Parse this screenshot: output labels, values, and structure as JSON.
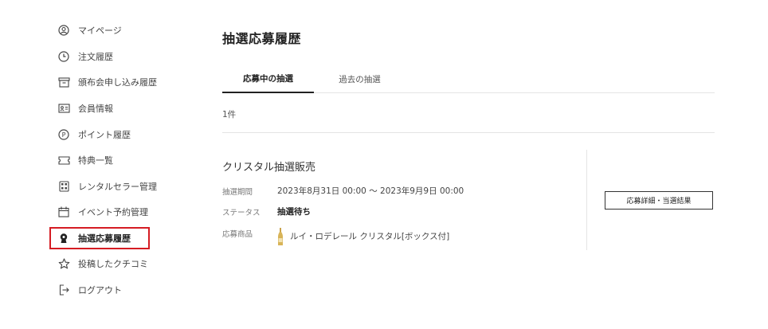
{
  "sidebar": {
    "items": [
      {
        "label": "マイページ",
        "icon": "person-circle-icon"
      },
      {
        "label": "注文履歴",
        "icon": "clock-icon"
      },
      {
        "label": "頒布会申し込み履歴",
        "icon": "box-icon"
      },
      {
        "label": "会員情報",
        "icon": "id-card-icon"
      },
      {
        "label": "ポイント履歴",
        "icon": "point-icon"
      },
      {
        "label": "特典一覧",
        "icon": "ticket-icon"
      },
      {
        "label": "レンタルセラー管理",
        "icon": "cellar-icon"
      },
      {
        "label": "イベント予約管理",
        "icon": "calendar-icon"
      },
      {
        "label": "抽選応募履歴",
        "icon": "lottery-icon",
        "active": true
      },
      {
        "label": "投稿したクチコミ",
        "icon": "star-icon"
      },
      {
        "label": "ログアウト",
        "icon": "logout-icon"
      }
    ],
    "active_border_color": "#d51c23"
  },
  "main": {
    "title": "抽選応募履歴",
    "tabs": [
      {
        "label": "応募中の抽選",
        "active": true
      },
      {
        "label": "過去の抽選",
        "active": false
      }
    ],
    "count": "1件",
    "entry": {
      "title": "クリスタル抽選販売",
      "period_label": "抽選期間",
      "period_value": "2023年8月31日 00:00 〜 2023年9月9日 00:00",
      "status_label": "ステータス",
      "status_value": "抽選待ち",
      "product_label": "応募商品",
      "product_value": "ルイ・ロデレール クリスタル[ボックス付]",
      "details_button": "応募詳細・当選結果"
    }
  }
}
